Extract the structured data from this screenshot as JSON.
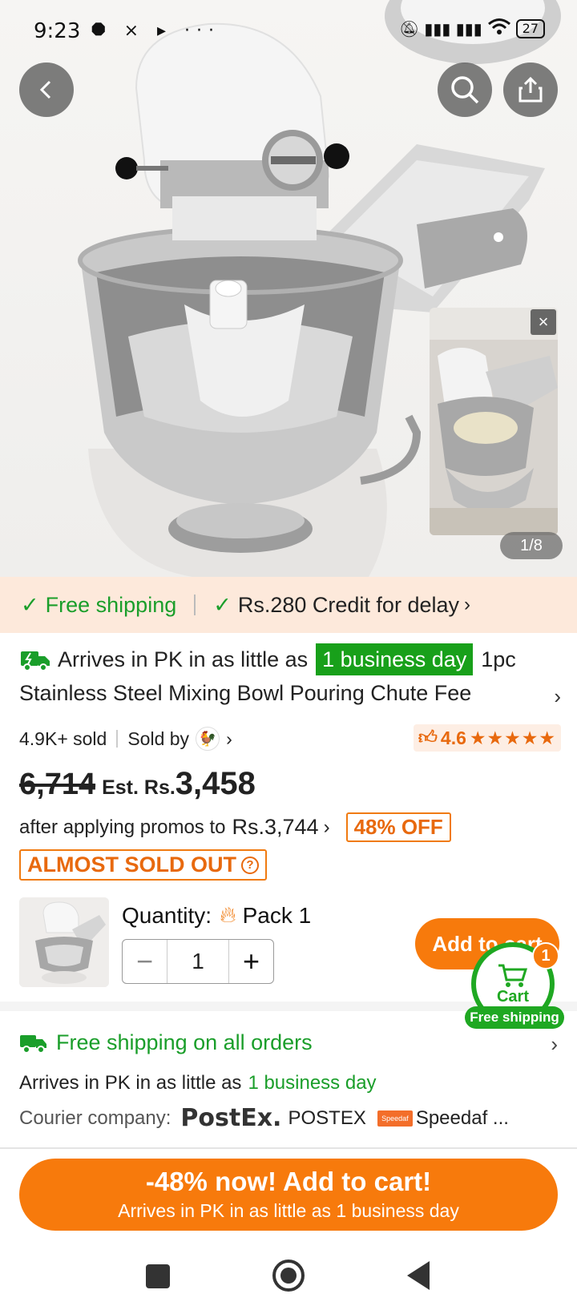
{
  "status_bar": {
    "time": "9:23",
    "notifications": "⯃ ⨯ ▸ ···",
    "signal": "▮▮▮ ▮▮▮",
    "battery": "27"
  },
  "hero": {
    "counter": "1/8",
    "video_close": "×"
  },
  "promo_strip": {
    "free_shipping": "Free shipping",
    "credit": "Rs.280 Credit for delay"
  },
  "product": {
    "arrive_prefix": "Arrives in PK in as little as",
    "arrive_highlight": "1 business day",
    "title_start": "1pc",
    "title_cont": "Stainless Steel Mixing Bowl Pouring Chute Fee",
    "sold": "4.9K+ sold",
    "sold_by": "Sold by",
    "rating": "4.6",
    "rating_value": 4.6,
    "stars": "★★★★★"
  },
  "price": {
    "original": "6,714",
    "est_label": "Est. Rs.",
    "est_value": "3,458",
    "promo_prefix": "after applying promos to",
    "promo_amount": "Rs.3,744",
    "off_badge": "48% OFF",
    "stock_badge": "ALMOST SOLD OUT"
  },
  "quantity": {
    "label": "Quantity:",
    "variant": "Pack 1",
    "value": "1",
    "minus": "−",
    "plus": "+"
  },
  "cart": {
    "add_to_cart": "Add to cart",
    "cart_label": "Cart",
    "count": "1",
    "free_shipping": "Free shipping"
  },
  "shipping": {
    "title": "Free shipping on all orders",
    "arrive_prefix": "Arrives in PK in as little as",
    "arrive_highlight": "1 business day",
    "courier_label": "Courier company:",
    "courier_logo": "PostEx.",
    "courier_1": "POSTEX",
    "courier_2": "Speedaf ..."
  },
  "cta": {
    "main": "-48% now! Add to cart!",
    "sub": "Arrives in PK in as little as 1 business day"
  },
  "colors": {
    "accent_orange": "#f77a0c",
    "accent_green": "#1a9e2a",
    "promo_bg": "#fde9db"
  }
}
